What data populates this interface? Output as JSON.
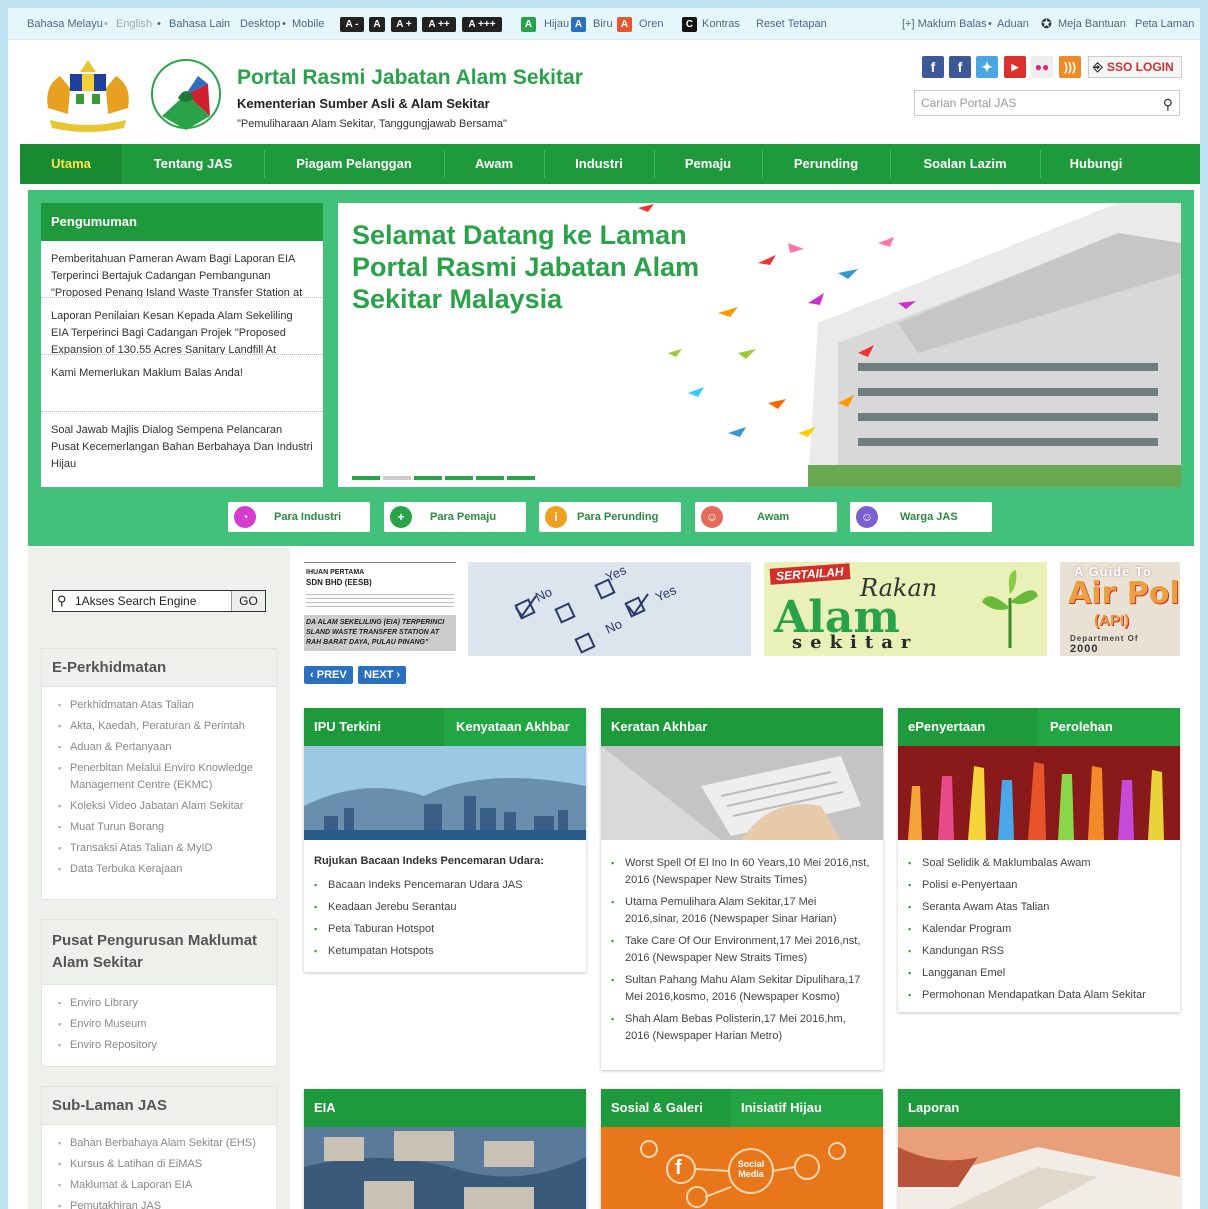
{
  "topbar": {
    "lang": [
      "Bahasa Melayu",
      "English",
      "Bahasa Lain"
    ],
    "view": [
      "Desktop",
      "Mobile"
    ],
    "text_sizes": [
      "A -",
      "A",
      "A +",
      "A ++",
      "A +++"
    ],
    "themes": [
      {
        "key": "A",
        "label": "Hijau",
        "color": "#2aa24a"
      },
      {
        "key": "A",
        "label": "Biru",
        "color": "#2b6fbf"
      },
      {
        "key": "A",
        "label": "Oren",
        "color": "#e4572e"
      }
    ],
    "contrast_key": "C",
    "contrast_label": "Kontras",
    "reset": "Reset Tetapan",
    "feedback": "[+] Maklum Balas",
    "complaint": "Aduan",
    "helpdesk": "Meja Bantuan",
    "sitemap": "Peta Laman"
  },
  "header": {
    "title": "Portal Rasmi Jabatan Alam Sekitar",
    "subtitle": "Kementerian Sumber Asli & Alam Sekitar",
    "tagline": "\"Pemuliharaan Alam Sekitar, Tanggungjawab Bersama\"",
    "sso": "SSO LOGIN",
    "search_placeholder": "Carian Portal JAS"
  },
  "nav": [
    "Utama",
    "Tentang JAS",
    "Piagam Pelanggan",
    "Awam",
    "Industri",
    "Pemaju",
    "Perunding",
    "Soalan Lazim",
    "Hubungi"
  ],
  "announcements": {
    "title": "Pengumuman",
    "items": [
      "Pemberitahuan Pameran Awam Bagi Laporan EIA Terperinci Bertajuk Cadangan Pembangunan \"Proposed Penang Island Waste Transfer Station at",
      "Laporan Penilaian Kesan Kepada Alam Sekeliling EIA Terperinci Bagi Cadangan Projek \"Proposed Expansion of 130.55 Acres Sanitary Landfill At",
      "Kami Memerlukan Maklum Balas Anda!",
      "Soal Jawab Majlis Dialog Sempena Pelancaran Pusat Kecemerlangan Bahan Berbahaya Dan Industri Hijau"
    ]
  },
  "slide": {
    "headline": "Selamat Datang ke Laman Portal Rasmi Jabatan Alam Sekitar Malaysia"
  },
  "audiences": [
    {
      "label": "Para Industri",
      "color": "#d63bd0"
    },
    {
      "label": "Para Pemaju",
      "color": "#2aa24a"
    },
    {
      "label": "Para Perunding",
      "color": "#f0a020"
    },
    {
      "label": "Awam",
      "color": "#e46a5a"
    },
    {
      "label": "Warga JAS",
      "color": "#7a5fd0"
    }
  ],
  "akses": {
    "label": "1Akses Search Engine",
    "go": "GO"
  },
  "eperkhidmatan": {
    "title": "E-Perkhidmatan",
    "items": [
      "Perkhidmatan Atas Talian",
      "Akta, Kaedah, Peraturan & Perintah",
      "Aduan & Pertanyaan",
      "Penerbitan Melalui Enviro Knowledge Management Centre (EKMC)",
      "Koleksi Video Jabatan Alam Sekitar",
      "Muat Turun Borang",
      "Transaksi Atas Talian & MyID",
      "Data Terbuka Kerajaan"
    ]
  },
  "pusat": {
    "title": "Pusat Pengurusan Maklumat Alam Sekitar",
    "items": [
      "Enviro Library",
      "Enviro Museum",
      "Enviro Repository"
    ]
  },
  "sublaman": {
    "title": "Sub-Laman JAS",
    "items": [
      "Bahan Berbahaya Alam Sekitar (EHS)",
      "Kursus & Latihan di EiMAS",
      "Maklumat & Laporan EIA",
      "Pemutakhiran JAS"
    ]
  },
  "banners": {
    "b1": [
      "IHUAN PERTAMA",
      "SDN BHD (EESB)",
      "DA ALAM SEKELILING (EIA) TERPERINCI SLAND WASTE TRANSFER STATION AT RAH BARAT DAYA, PULAU PINANG\""
    ],
    "b3_top": "SERTAILAH",
    "b3_mid": "Rakan",
    "b3_main": "Alam",
    "b3_bot": "sekitar",
    "b4_top": "A Guide To",
    "b4_main": "Air Pollu",
    "b4_sub": "(API)",
    "b4_dept": "Department Of",
    "b4_year": "2000",
    "prev": "PREV",
    "next": "NEXT"
  },
  "cards": {
    "ipu": {
      "tab1": "IPU Terkini",
      "tab2": "Kenyataan Akhbar",
      "heading": "Rujukan Bacaan Indeks Pencemaran Udara:",
      "items": [
        "Bacaan Indeks Pencemaran Udara JAS",
        "Keadaan Jerebu Serantau",
        "Peta Taburan Hotspot",
        "Ketumpatan Hotspots"
      ]
    },
    "keratan": {
      "tab1": "Keratan Akhbar",
      "items": [
        "Worst Spell Of El Ino In 60 Years,10 Mei 2016,nst, 2016 (Newspaper New Straits Times)",
        "Utama Pemulihara Alam Sekitar,17 Mei 2016,sinar, 2016 (Newspaper Sinar Harian)",
        "Take Care Of Our Environment,17 Mei 2016,nst, 2016 (Newspaper New Straits Times)",
        "Sultan Pahang Mahu Alam Sekitar Dipulihara,17 Mei 2016,kosmo, 2016 (Newspaper Kosmo)",
        "Shah Alam Bebas Polisterin,17 Mei 2016,hm, 2016 (Newspaper Harian Metro)"
      ]
    },
    "epenyertaan": {
      "tab1": "ePenyertaan",
      "tab2": "Perolehan",
      "items": [
        "Soal Selidik & Maklumbalas Awam",
        "Polisi e-Penyertaan",
        "Seranta Awam Atas Talian",
        "Kalendar Program",
        "Kandungan RSS",
        "Langganan Emel",
        "Permohonan Mendapatkan Data Alam Sekitar"
      ]
    },
    "eia": {
      "tab1": "EIA"
    },
    "sosial": {
      "tab1": "Sosial & Galeri",
      "tab2": "Inisiatif Hijau",
      "img_text": "Social Media"
    },
    "laporan": {
      "tab1": "Laporan"
    }
  }
}
